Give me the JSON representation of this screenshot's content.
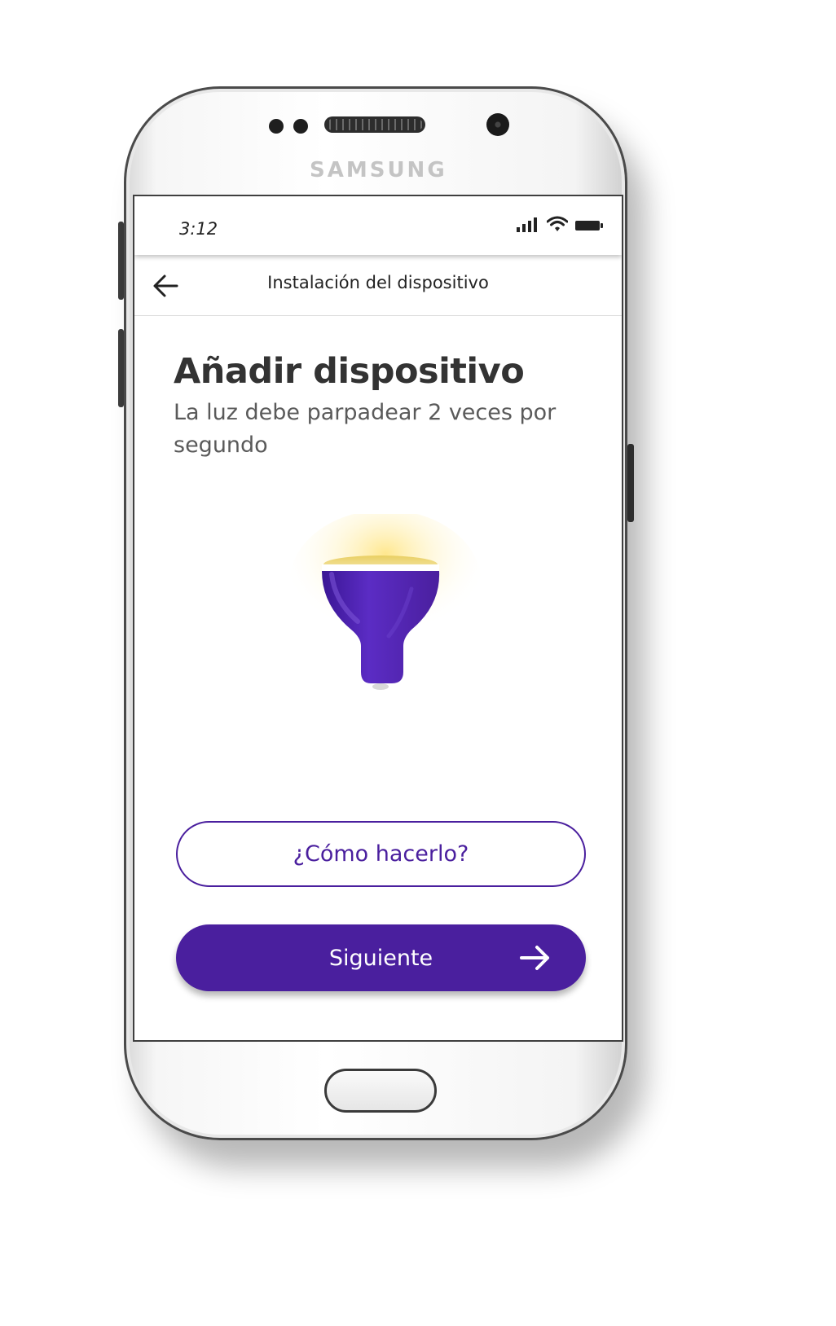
{
  "device": {
    "brand": "SAMSUNG"
  },
  "status_bar": {
    "time": "3:12",
    "icons": [
      "signal-icon",
      "wifi-icon",
      "battery-icon"
    ]
  },
  "app_bar": {
    "title": "Instalación del dispositivo",
    "back_icon": "arrow-left-icon"
  },
  "main": {
    "heading": "Añadir dispositivo",
    "subtitle": "La luz debe parpadear 2 veces por segundo",
    "illustration": "light-bulb-icon"
  },
  "actions": {
    "how_to_label": "¿Cómo hacerlo?",
    "next_label": "Siguiente",
    "next_icon": "arrow-right-icon"
  },
  "colors": {
    "accent": "#4a1f9e",
    "text": "#333333",
    "subtitle": "#5a5a5a"
  }
}
